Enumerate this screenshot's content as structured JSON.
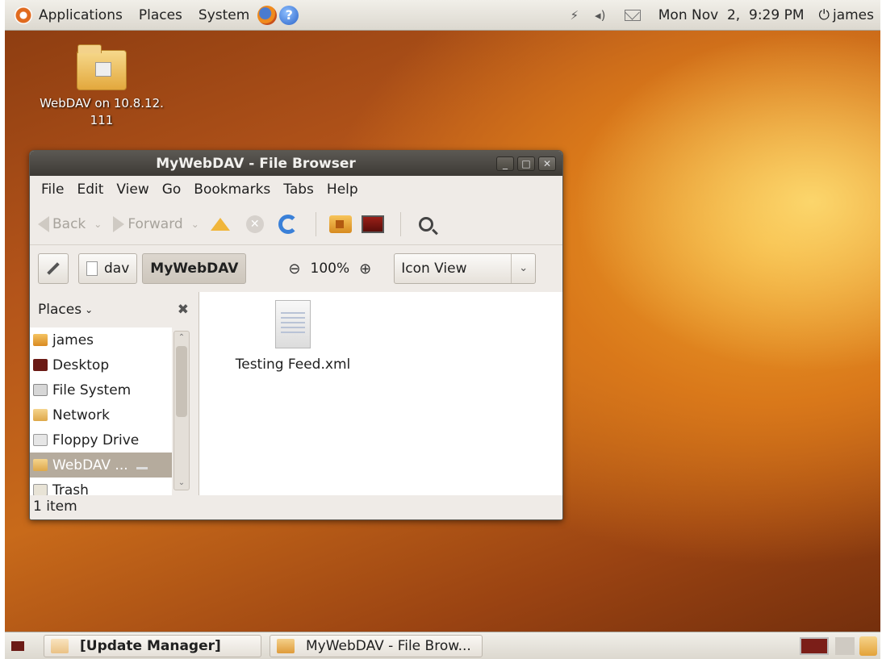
{
  "top_panel": {
    "menus": [
      "Applications",
      "Places",
      "System"
    ],
    "clock": "Mon Nov  2,  9:29 PM",
    "user": "james"
  },
  "desktop": {
    "icon_label_line1": "WebDAV on 10.8.12.",
    "icon_label_line2": "111"
  },
  "window": {
    "title": "MyWebDAV - File Browser",
    "menubar": [
      "File",
      "Edit",
      "View",
      "Go",
      "Bookmarks",
      "Tabs",
      "Help"
    ],
    "toolbar": {
      "back": "Back",
      "forward": "Forward"
    },
    "location": {
      "crumb1": "dav",
      "crumb2": "MyWebDAV",
      "zoom": "100%",
      "view": "Icon View"
    },
    "sidebar": {
      "header": "Places",
      "items": [
        "james",
        "Desktop",
        "File System",
        "Network",
        "Floppy Drive",
        "WebDAV ...",
        "Trash"
      ]
    },
    "files": [
      {
        "name": "Testing Feed.xml"
      }
    ],
    "status": "1 item"
  },
  "taskbar": {
    "tasks": [
      "[Update Manager]",
      "MyWebDAV - File Brow..."
    ]
  }
}
